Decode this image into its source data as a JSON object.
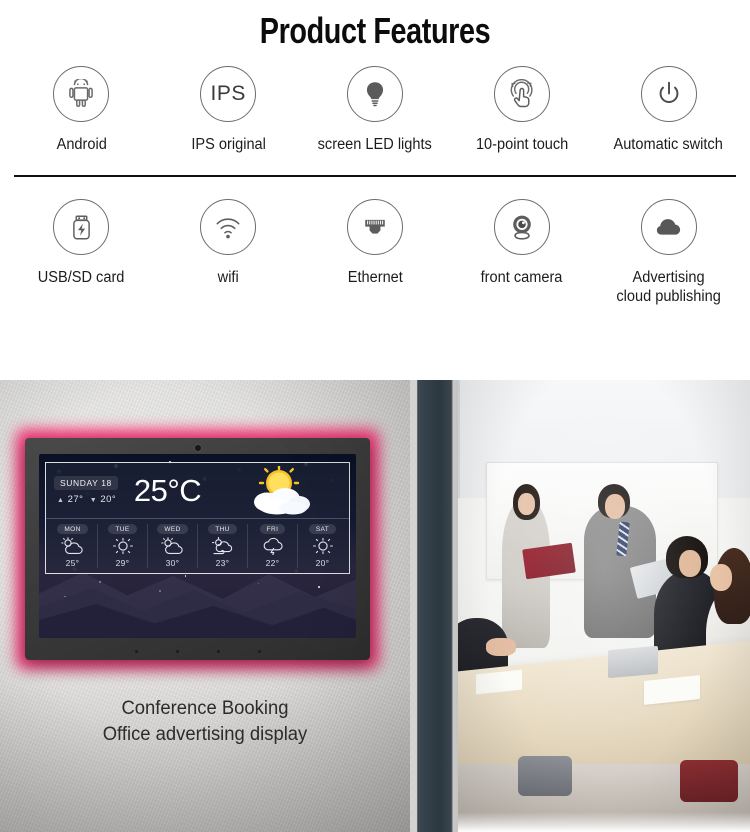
{
  "header": {
    "title": "Product Features"
  },
  "features": {
    "row1": [
      {
        "label": "Android",
        "icon": "android-icon"
      },
      {
        "label": "IPS original",
        "icon": "ips-icon",
        "icon_text": "IPS"
      },
      {
        "label": "screen LED lights",
        "icon": "lightbulb-icon"
      },
      {
        "label": "10-point touch",
        "icon": "touch-gesture-icon"
      },
      {
        "label": "Automatic switch",
        "icon": "power-icon"
      }
    ],
    "row2": [
      {
        "label": "USB/SD card",
        "icon": "usb-drive-icon"
      },
      {
        "label": "wifi",
        "icon": "wifi-icon"
      },
      {
        "label": "Ethernet",
        "icon": "ethernet-port-icon"
      },
      {
        "label": "front camera",
        "icon": "webcam-icon"
      },
      {
        "label": "Advertising\ncloud publishing",
        "icon": "cloud-icon"
      }
    ]
  },
  "showcase": {
    "caption": "Conference Booking\nOffice advertising display",
    "led_color": "#ff2d74",
    "screen": {
      "weather": {
        "day_label": "SUNDAY 18",
        "high": "27°",
        "low": "20°",
        "high_arrow": "▲",
        "low_arrow": "▼",
        "current_temp": "25°C",
        "condition_icon": "sun-behind-cloud-icon",
        "forecast": [
          {
            "day": "MON",
            "temp": "25°",
            "icon": "sun-cloud-icon"
          },
          {
            "day": "TUE",
            "temp": "29°",
            "icon": "sun-icon"
          },
          {
            "day": "WED",
            "temp": "30°",
            "icon": "sun-cloud-icon"
          },
          {
            "day": "THU",
            "temp": "23°",
            "icon": "wind-cloud-icon"
          },
          {
            "day": "FRI",
            "temp": "22°",
            "icon": "thunderstorm-icon"
          },
          {
            "day": "SAT",
            "temp": "20°",
            "icon": "sun-icon"
          }
        ]
      }
    }
  },
  "office_photo": {
    "alt": "meeting-room-photo"
  }
}
